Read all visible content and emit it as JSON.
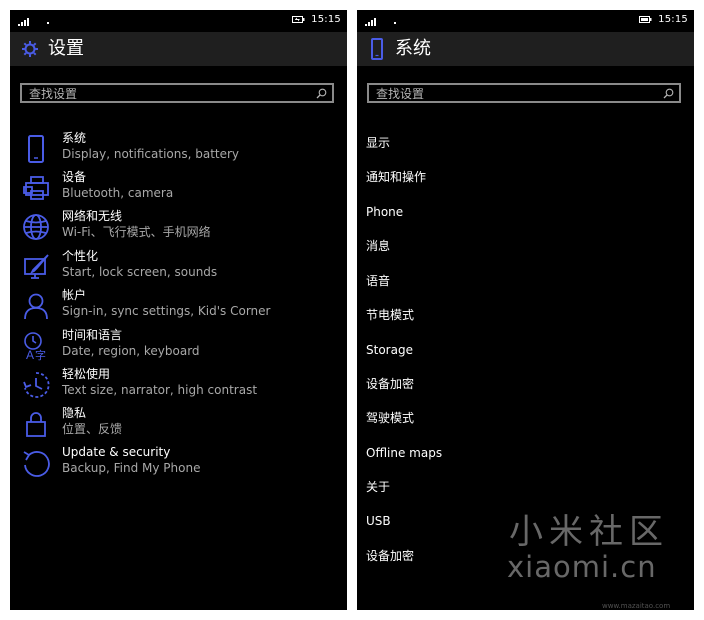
{
  "colors": {
    "accent": "#4a5ce6",
    "background": "#000000",
    "titlebar": "#1f1f1f",
    "subtext": "#a8a8a8"
  },
  "left": {
    "status": {
      "time": "15:15"
    },
    "title": "设置",
    "title_icon": "gear-icon",
    "search_placeholder": "查找设置",
    "items": [
      {
        "icon": "phone-icon",
        "title": "系统",
        "subtitle": "Display, notifications, battery"
      },
      {
        "icon": "keyboard-printer-icon",
        "title": "设备",
        "subtitle": "Bluetooth, camera"
      },
      {
        "icon": "globe-icon",
        "title": "网络和无线",
        "subtitle": "Wi-Fi、飞行模式、手机网络"
      },
      {
        "icon": "paintbrush-icon",
        "title": "个性化",
        "subtitle": "Start, lock screen, sounds"
      },
      {
        "icon": "person-icon",
        "title": "帐户",
        "subtitle": "Sign-in, sync settings, Kid's Corner"
      },
      {
        "icon": "time-language-icon",
        "title": "时间和语言",
        "subtitle": "Date, region, keyboard"
      },
      {
        "icon": "ease-of-access-icon",
        "title": "轻松使用",
        "subtitle": "Text size, narrator, high contrast"
      },
      {
        "icon": "lock-icon",
        "title": "隐私",
        "subtitle": "位置、反馈"
      },
      {
        "icon": "update-icon",
        "title": "Update & security",
        "subtitle": "Backup, Find My Phone"
      }
    ]
  },
  "right": {
    "status": {
      "time": "15:15"
    },
    "title": "系统",
    "title_icon": "phone-icon",
    "search_placeholder": "查找设置",
    "items": [
      "显示",
      "通知和操作",
      "Phone",
      "消息",
      "语音",
      "节电模式",
      "Storage",
      "设备加密",
      "驾驶模式",
      "Offline maps",
      "关于",
      "USB",
      "设备加密"
    ]
  },
  "watermark": {
    "cn": "小米社区",
    "en": "xiaomi.cn",
    "url": "www.mazaitao.com"
  }
}
